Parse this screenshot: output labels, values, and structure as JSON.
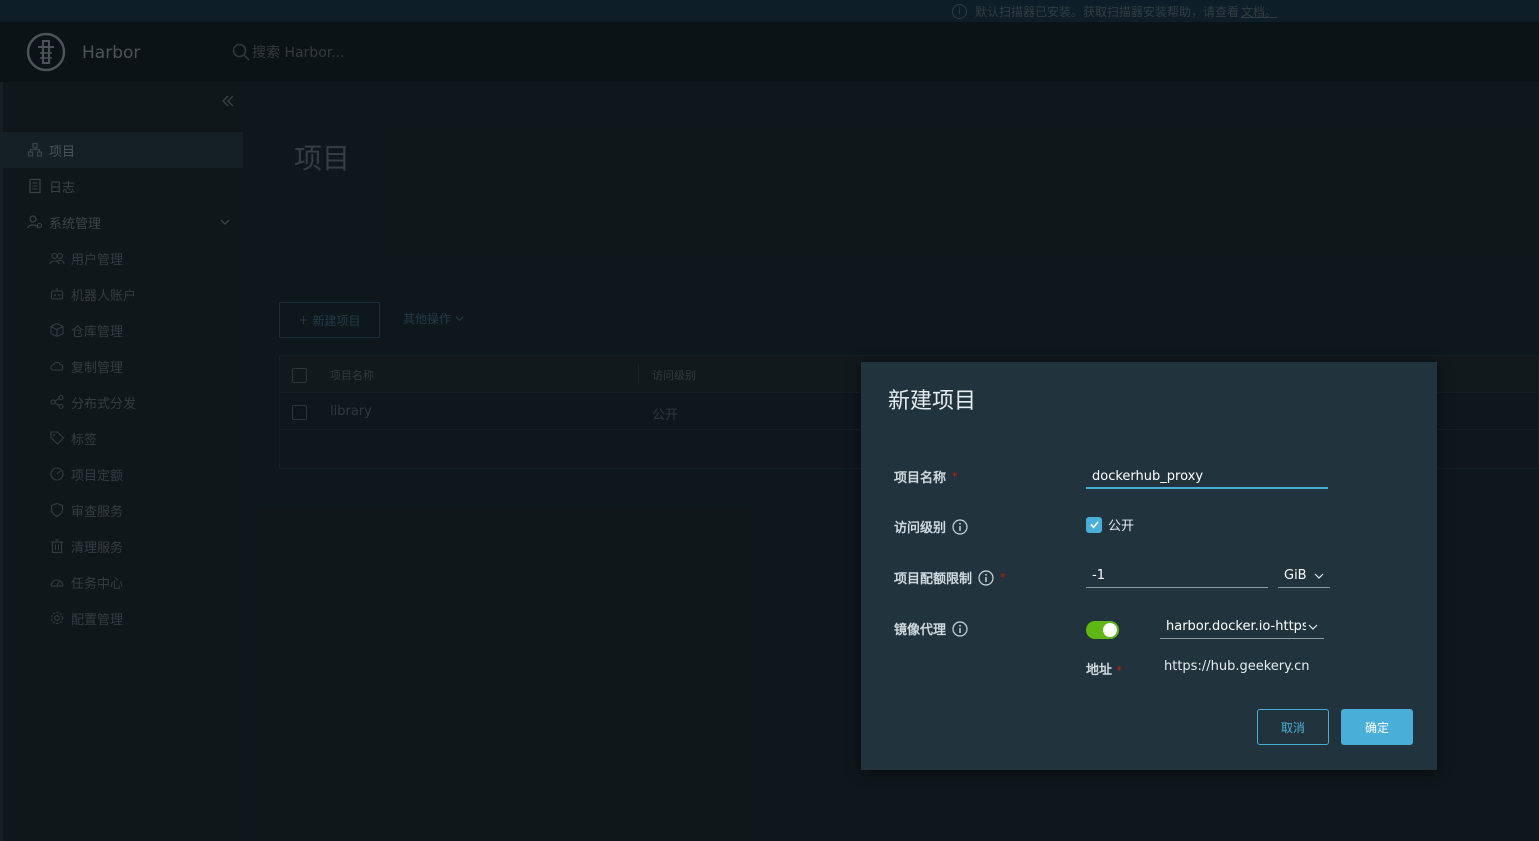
{
  "banner": {
    "text": "默认扫描器已安装。获取扫描器安装帮助，请查看",
    "link": "文档。"
  },
  "header": {
    "brand": "Harbor",
    "search_placeholder": "搜索 Harbor..."
  },
  "sidebar": {
    "items": [
      {
        "label": "项目",
        "icon": "projects-icon",
        "active": true
      },
      {
        "label": "日志",
        "icon": "logs-icon"
      },
      {
        "label": "系统管理",
        "icon": "admin-icon",
        "expandable": true
      }
    ],
    "sub_items": [
      {
        "label": "用户管理",
        "icon": "users-icon"
      },
      {
        "label": "机器人账户",
        "icon": "robot-icon"
      },
      {
        "label": "仓库管理",
        "icon": "registry-icon"
      },
      {
        "label": "复制管理",
        "icon": "replication-icon"
      },
      {
        "label": "分布式分发",
        "icon": "share-icon"
      },
      {
        "label": "标签",
        "icon": "tag-icon"
      },
      {
        "label": "项目定额",
        "icon": "quota-icon"
      },
      {
        "label": "审查服务",
        "icon": "shield-icon"
      },
      {
        "label": "清理服务",
        "icon": "trash-icon"
      },
      {
        "label": "任务中心",
        "icon": "dashboard-icon"
      },
      {
        "label": "配置管理",
        "icon": "gear-icon"
      }
    ]
  },
  "main": {
    "title": "项目",
    "new_project_label": "新建项目",
    "other_actions_label": "其他操作",
    "table": {
      "columns": [
        "项目名称",
        "访问级别"
      ],
      "rows": [
        {
          "name": "library",
          "access": "公开"
        }
      ]
    }
  },
  "modal": {
    "title": "新建项目",
    "project_name_label": "项目名称",
    "project_name_value": "dockerhub_proxy",
    "access_level_label": "访问级别",
    "access_public_label": "公开",
    "access_public_checked": true,
    "quota_label": "项目配额限制",
    "quota_value": "-1",
    "quota_unit": "GiB",
    "proxy_label": "镜像代理",
    "proxy_enabled": true,
    "proxy_registry": "harbor.docker.io-https://hub.geekery.cn",
    "endpoint_label": "地址",
    "endpoint_value": "https://hub.geekery.cn",
    "cancel_label": "取消",
    "ok_label": "确定",
    "required_mark": "*"
  },
  "colors": {
    "accent": "#49afd9",
    "toggle_on": "#5eb715",
    "required": "#c92100",
    "header_bg": "#17242b",
    "modal_bg": "#21333d"
  }
}
